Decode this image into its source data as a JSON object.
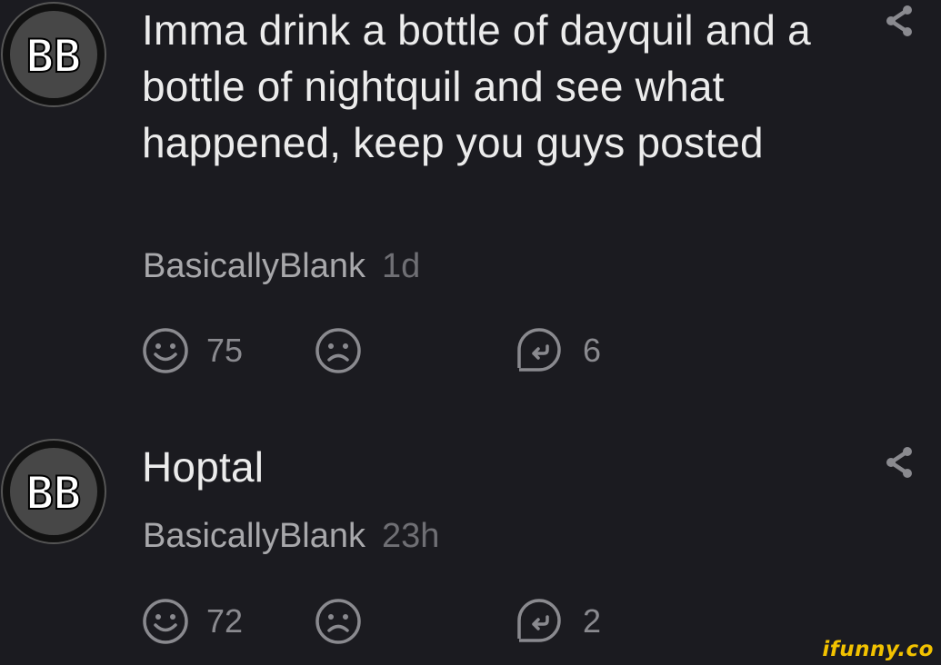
{
  "comments": [
    {
      "avatar_text": "BB",
      "text": "Imma drink a bottle of dayquil and a bottle of nightquil and see what happened, keep you guys posted",
      "author": "BasicallyBlank",
      "time": "1d",
      "likes": "75",
      "replies": "6"
    },
    {
      "avatar_text": "BB",
      "text": "Hoptal",
      "author": "BasicallyBlank",
      "time": "23h",
      "likes": "72",
      "replies": "2"
    }
  ],
  "icons": {
    "share": "share-icon",
    "like": "smile-icon",
    "dislike": "frown-icon",
    "reply": "reply-icon"
  },
  "colors": {
    "background": "#1b1b20",
    "text": "#ececec",
    "author": "#a8a8ab",
    "muted": "#6f6f74",
    "watermark": "#f2c200"
  },
  "watermark": "ifunny.co"
}
